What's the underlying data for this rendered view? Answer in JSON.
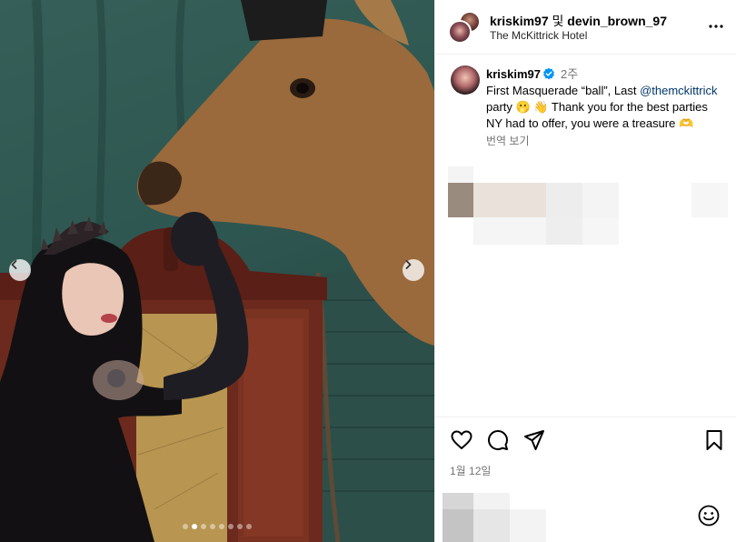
{
  "post": {
    "header": {
      "user_primary": "kriskim97",
      "conjunction": "및",
      "user_secondary": "devin_brown_97",
      "location": "The McKittrick Hotel"
    },
    "caption": {
      "username": "kriskim97",
      "time_ago": "2주",
      "text_part1": "First Masquerade “ball”, Last ",
      "mention": "@themckittrick",
      "text_part2": " party 🫢 👋 Thank you for the best parties NY had to offer, you were a treasure 🫶",
      "translate_label": "번역 보기"
    },
    "date": "1월 12일",
    "carousel": {
      "slide_count": 8,
      "active_index": 1
    },
    "icons": {
      "more": "more-horizontal-icon",
      "verified": "verified-badge-icon",
      "like": "heart-icon",
      "comment": "comment-bubble-icon",
      "share": "paper-plane-icon",
      "save": "bookmark-icon",
      "emoji": "smiley-icon",
      "prev": "chevron-left-icon",
      "next": "chevron-right-icon"
    },
    "colors": {
      "verified": "#0095f6",
      "mention": "#00376b",
      "muted": "#737373",
      "divider": "#efefef"
    }
  }
}
